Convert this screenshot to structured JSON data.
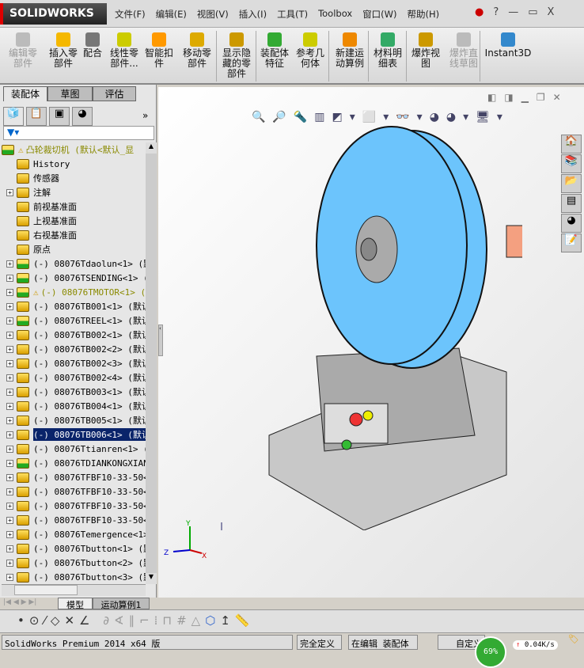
{
  "app": {
    "logo": "SOLIDWORKS"
  },
  "menu": [
    "文件(F)",
    "编辑(E)",
    "视图(V)",
    "插入(I)",
    "工具(T)",
    "Toolbox",
    "窗口(W)",
    "帮助(H)"
  ],
  "window_controls": {
    "help": "?",
    "minimize": "—",
    "restore": "▭",
    "close": "X"
  },
  "toolbar": [
    {
      "label": "编辑零\n部件",
      "disabled": true
    },
    {
      "label": "插入零\n部件"
    },
    {
      "label": "配合"
    },
    {
      "label": "线性零\n部件..."
    },
    {
      "label": "智能扣\n件"
    },
    {
      "label": "移动零\n部件"
    },
    {
      "label": "显示隐\n藏的零\n部件"
    },
    {
      "label": "装配体\n特征"
    },
    {
      "label": "参考几\n何体"
    },
    {
      "label": "新建运\n动算例"
    },
    {
      "label": "材料明\n细表"
    },
    {
      "label": "爆炸视\n图"
    },
    {
      "label": "爆炸直\n线草图",
      "disabled": true
    },
    {
      "label": "Instant3D"
    }
  ],
  "left_tabs": [
    "装配体",
    "草图",
    "评估"
  ],
  "tree": {
    "root": "凸轮裁切机  (默认<默认_显",
    "items": [
      {
        "label": "History",
        "expand": false
      },
      {
        "label": "传感器",
        "expand": false
      },
      {
        "label": "注解",
        "expand": true
      },
      {
        "label": "前视基准面",
        "expand": false
      },
      {
        "label": "上视基准面",
        "expand": false
      },
      {
        "label": "右视基准面",
        "expand": false
      },
      {
        "label": "原点",
        "expand": false
      },
      {
        "label": "(-) 08076Tdaolun<1> (默",
        "expand": true,
        "comp": "asm"
      },
      {
        "label": "(-) 08076TSENDING<1> (默",
        "expand": true,
        "comp": "asm"
      },
      {
        "label": "(-) 08076TMOTOR<1> (",
        "expand": true,
        "comp": "asm",
        "warning": true
      },
      {
        "label": "(-) 08076TB001<1> (默认",
        "expand": true,
        "comp": "part"
      },
      {
        "label": "(-) 08076TREEL<1> (默认",
        "expand": true,
        "comp": "asm"
      },
      {
        "label": "(-) 08076TB002<1> (默认",
        "expand": true,
        "comp": "part"
      },
      {
        "label": "(-) 08076TB002<2> (默认",
        "expand": true,
        "comp": "part"
      },
      {
        "label": "(-) 08076TB002<3> (默认",
        "expand": true,
        "comp": "part"
      },
      {
        "label": "(-) 08076TB002<4> (默认",
        "expand": true,
        "comp": "part"
      },
      {
        "label": "(-) 08076TB003<1> (默认",
        "expand": true,
        "comp": "part"
      },
      {
        "label": "(-) 08076TB004<1> (默认",
        "expand": true,
        "comp": "part"
      },
      {
        "label": "(-) 08076TB005<1> (默认",
        "expand": true,
        "comp": "part"
      },
      {
        "label": "(-) 08076TB006<1> (默认",
        "expand": true,
        "comp": "part",
        "selected": true
      },
      {
        "label": "(-) 08076Ttianren<1> (默",
        "expand": true,
        "comp": "part"
      },
      {
        "label": "(-) 08076TDIANKONGXIANG",
        "expand": true,
        "comp": "asm"
      },
      {
        "label": "(-) 08076TFBF10-33-50<1",
        "expand": true,
        "comp": "part"
      },
      {
        "label": "(-) 08076TFBF10-33-50<2",
        "expand": true,
        "comp": "part"
      },
      {
        "label": "(-) 08076TFBF10-33-50<3",
        "expand": true,
        "comp": "part"
      },
      {
        "label": "(-) 08076TFBF10-33-50<4",
        "expand": true,
        "comp": "part"
      },
      {
        "label": "(-) 08076Temergence<1>",
        "expand": true,
        "comp": "part"
      },
      {
        "label": "(-) 08076Tbutton<1> (默",
        "expand": true,
        "comp": "part"
      },
      {
        "label": "(-) 08076Tbutton<2> (默",
        "expand": true,
        "comp": "part"
      },
      {
        "label": "(-) 08076Tbutton<3> (默",
        "expand": true,
        "comp": "part"
      }
    ]
  },
  "bottom_tabs": [
    "模型",
    "运动算例1"
  ],
  "status": {
    "product": "SolidWorks Premium 2014 x64 版",
    "state": "完全定义",
    "mode": "在编辑 装配体",
    "custom": "自定义",
    "net_percent": "69%",
    "net_speed": "0.04K/s"
  },
  "triad": {
    "x": "X",
    "y": "Y",
    "z": "Z"
  },
  "colors": {
    "reel": "#6cc4fc",
    "motor": "#f4a080",
    "selection": "#0a246a"
  }
}
